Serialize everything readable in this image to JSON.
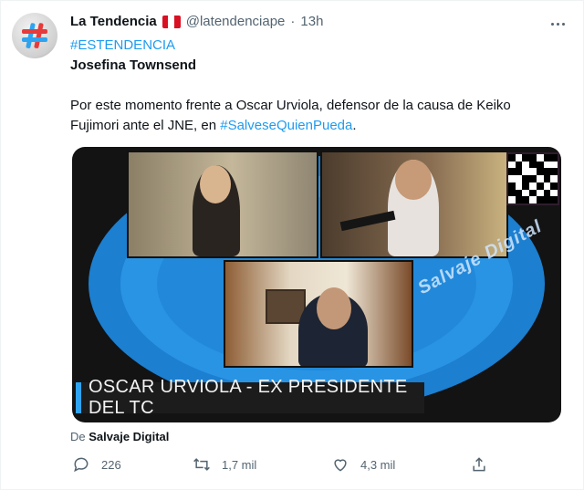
{
  "author": {
    "name": "La Tendencia",
    "handle": "@latendenciape",
    "separator": "·",
    "time": "13h"
  },
  "colors": {
    "flag_red": "#d91023",
    "flag_white": "#ffffff",
    "accent": "#1d9bf0",
    "brand_blue": "#2fa3ef"
  },
  "tweet": {
    "hashtag": "#ESTENDENCIA",
    "title": "Josefina Townsend",
    "body_text": "Por este momento frente a Oscar Urviola, defensor de la causa de Keiko Fujimori ante el JNE, en ",
    "body_link": "#SalveseQuienPueda",
    "body_end": "."
  },
  "media": {
    "lower_third": "OSCAR URVIOLA - EX PRESIDENTE DEL TC",
    "watermark": "Salvaje Digital"
  },
  "source": {
    "prefix": "De ",
    "name": "Salvaje Digital"
  },
  "actions": {
    "replies": "226",
    "retweets": "1,7 mil",
    "likes": "4,3 mil"
  },
  "icons": [
    "more-icon",
    "reply-icon",
    "retweet-icon",
    "like-icon",
    "share-icon"
  ]
}
